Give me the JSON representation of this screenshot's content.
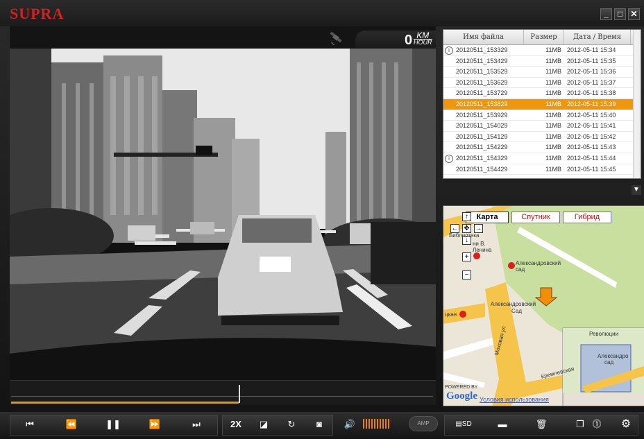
{
  "app": {
    "logo": "SUPRA"
  },
  "window": {
    "minimize": "_",
    "maximize": "□",
    "close": "✕"
  },
  "speed": {
    "value": "0",
    "unit_top": "KM",
    "unit_bottom": "HOUR"
  },
  "timeline": {
    "progress_fraction": 0.54
  },
  "filelist": {
    "columns": [
      "Имя файла",
      "Размер",
      "Дата / Время"
    ],
    "rows": [
      {
        "name": "20120511_153329",
        "size": "11MB",
        "date": "2012-05-11 15:34",
        "info": true
      },
      {
        "name": "20120511_153429",
        "size": "11MB",
        "date": "2012-05-11 15:35"
      },
      {
        "name": "20120511_153529",
        "size": "11MB",
        "date": "2012-05-11 15:36"
      },
      {
        "name": "20120511_153629",
        "size": "11MB",
        "date": "2012-05-11 15:37"
      },
      {
        "name": "20120511_153729",
        "size": "11MB",
        "date": "2012-05-11 15:38"
      },
      {
        "name": "20120511_153829",
        "size": "11MB",
        "date": "2012-05-11 15:39",
        "selected": true
      },
      {
        "name": "20120511_153929",
        "size": "11MB",
        "date": "2012-05-11 15:40"
      },
      {
        "name": "20120511_154029",
        "size": "11MB",
        "date": "2012-05-11 15:41"
      },
      {
        "name": "20120511_154129",
        "size": "11MB",
        "date": "2012-05-11 15:42"
      },
      {
        "name": "20120511_154229",
        "size": "11MB",
        "date": "2012-05-11 15:43"
      },
      {
        "name": "20120511_154329",
        "size": "11MB",
        "date": "2012-05-11 15:44",
        "info": true
      },
      {
        "name": "20120511_154429",
        "size": "11MB",
        "date": "2012-05-11 15:45"
      }
    ]
  },
  "map": {
    "tabs": [
      "Карта",
      "Спутник",
      "Гибрид"
    ],
    "labels": {
      "biblioteka": "Библиотека",
      "lenina": "ни В.",
      "lenina2": "Ленина",
      "alexgarden_metro": "Александровский",
      "alexgarden_metro2": "сад",
      "alexgarden": "Александровский",
      "alexgarden2": "Сад",
      "sad_left": "цкая",
      "mokhovaya": "Моховая ул",
      "kremlin": "Кремлевская",
      "revolution": "Революции",
      "mini_alex": "Александро",
      "mini_sad": "сад",
      "powered": "POWERED BY",
      "google": "Google",
      "terms": "Условия использования"
    }
  },
  "controls": {
    "speed_2x": "2X",
    "amp": "AMP"
  },
  "colors": {
    "accent": "#f0960a",
    "logo": "#d42020"
  }
}
